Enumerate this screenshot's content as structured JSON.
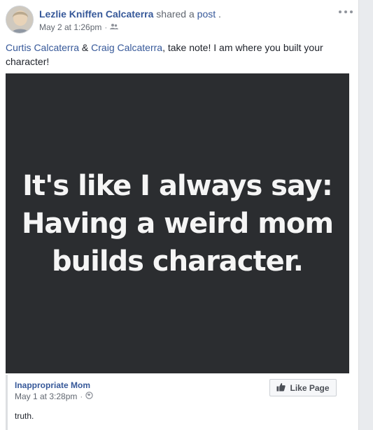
{
  "post": {
    "author": "Lezlie Kniffen Calcaterra",
    "action_prefix": "shared a ",
    "action_link": "post",
    "action_suffix": ".",
    "timestamp": "May 2 at 1:26pm",
    "meta_separator": "·",
    "audience_icon": "friends-icon",
    "more_icon": "more-options-icon",
    "caption": {
      "mention_1": "Curtis Calcaterra",
      "joiner": " & ",
      "mention_2": "Craig Calcaterra",
      "rest": ", take note! I am where you built your character!"
    },
    "image_text": "It's like I always say: Having a weird mom builds character."
  },
  "shared_source": {
    "page_name": "Inappropriate Mom",
    "timestamp": "May 1 at 3:28pm",
    "meta_separator": "·",
    "audience_icon": "globe-icon",
    "like_button_label": "Like Page",
    "like_icon": "thumbs-up-icon",
    "text": "truth."
  },
  "colors": {
    "link": "#365899",
    "meta": "#616770",
    "image_bg": "#2b2d30",
    "image_text": "#f5f5f5"
  }
}
